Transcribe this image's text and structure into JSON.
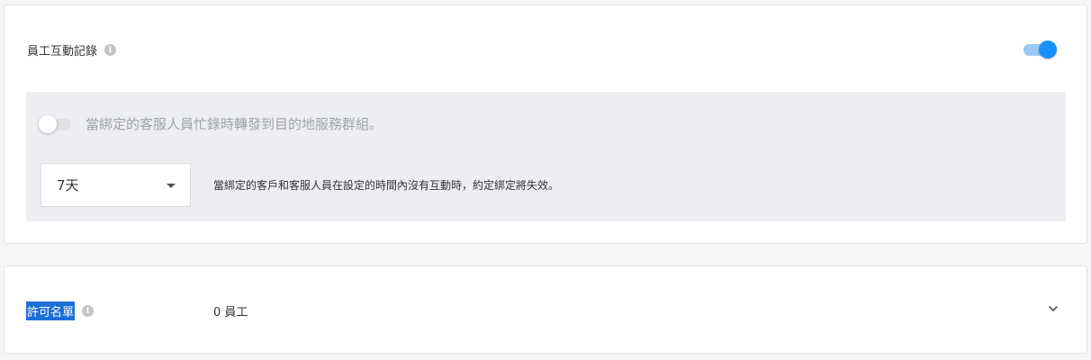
{
  "interaction_section": {
    "title": "員工互動記錄",
    "info_icon": "info-icon",
    "enabled": true,
    "busy_forward": {
      "enabled": false,
      "label": "當綁定的客服人員忙錄時轉發到目的地服務群組。"
    },
    "expiry": {
      "selected": "7天",
      "description": "當綁定的客戶和客服人員在設定的時間內沒有互動時，約定綁定將失效。"
    }
  },
  "allowlist_section": {
    "title": "許可名單",
    "info_icon": "info-icon",
    "count_text": "0 員工",
    "expand_icon": "chevron-down-icon"
  },
  "colors": {
    "accent": "#1890ff",
    "selection": "#1e6fd8",
    "panel_bg": "#edeef1"
  }
}
